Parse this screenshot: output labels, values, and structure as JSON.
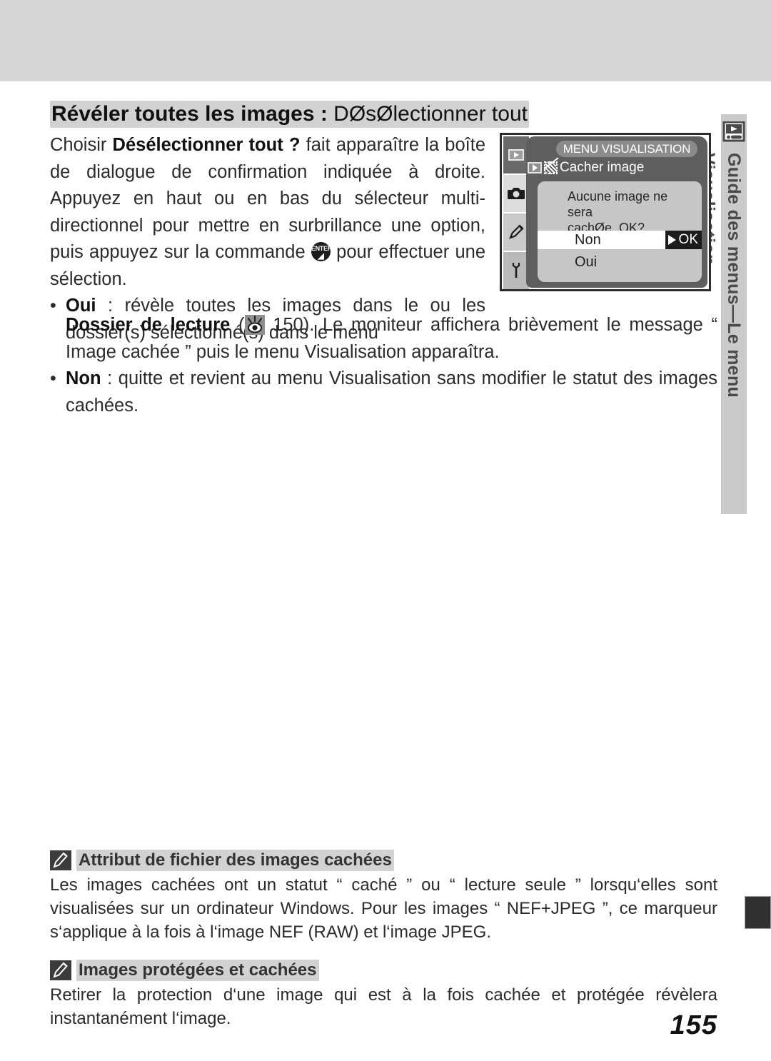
{
  "page": {
    "number": "155"
  },
  "side_tab": {
    "label": "Guide des menus—Le menu Visualisation",
    "icon": "playback-icon"
  },
  "heading": {
    "bold_part": "Révéler toutes les images :",
    "regular_part": " DØsØlectionner tout"
  },
  "intro": {
    "line_1_a": "Choisir ",
    "line_1_b": "Désélectionner tout ?",
    "line_1_c": " fait apparaître la boîte de dialogue de confirmation indiquée à droite. Appuyez en haut ou en bas du sélecteur multi-directionnel pour mettre en surbrillance une option, puis appuyez sur la commande ",
    "line_1_d": " pour effectuer une sélection."
  },
  "bullets": [
    {
      "dot": "•",
      "term": "Oui",
      "sep": " : ",
      "text_a": "révèle toutes les images dans le ou les dossier(s) sélectionné(s) dans le menu ",
      "term_2": "Dossier de lecture",
      "text_b": " (",
      "page_ref": "150",
      "text_c": "). Le moniteur affichera brièvement le message “ Image cachée ” puis le menu Visualisation apparaîtra."
    },
    {
      "dot": "•",
      "term": "Non",
      "sep": " : ",
      "text": "quitte et revient au menu Visualisation sans modifier le statut des images cachées."
    }
  ],
  "camera_menu": {
    "title": "MENU VISUALISATION",
    "submenu": "Cacher image",
    "tabs": [
      {
        "name": "playback-tab",
        "glyph": "▶",
        "selected": true
      },
      {
        "name": "shooting-tab",
        "glyph": "camera",
        "selected": false
      },
      {
        "name": "custom-settings-tab",
        "glyph": "pencil",
        "selected": false
      },
      {
        "name": "setup-tab",
        "glyph": "wrench",
        "selected": false
      }
    ],
    "dialog": {
      "message_line_1": "Aucune image ne sera",
      "message_line_2": "cachØe.  OK?",
      "options": [
        {
          "label": "Non",
          "selected": true,
          "action": "OK"
        },
        {
          "label": "Oui",
          "selected": false,
          "action": ""
        }
      ],
      "ok_label": "OK"
    }
  },
  "notes": [
    {
      "icon": "pencil-note-icon",
      "title": "Attribut de fichier des images cachées",
      "body": "Les images cachées ont un statut “ caché ” ou “ lecture seule ” lorsqu‘elles sont visualisées sur un ordinateur Windows. Pour les images “ NEF+JPEG ”, ce marqueur s‘applique à la fois à l‘image NEF (RAW) et l‘image JPEG."
    },
    {
      "icon": "pencil-note-icon",
      "title": "Images protégées et cachées",
      "body": "Retirer la protection d‘une image qui est à la fois cachée et protégée révèlera instantanément l‘image."
    }
  ],
  "colors": {
    "band_gray": "#d6d6d6",
    "highlight_gray": "#d2d2d2",
    "strip_gray": "#cacaca",
    "menu_dark": "#5e5e5e",
    "dialog_gray": "#c6c6c6",
    "dark_tab": "#303030"
  }
}
